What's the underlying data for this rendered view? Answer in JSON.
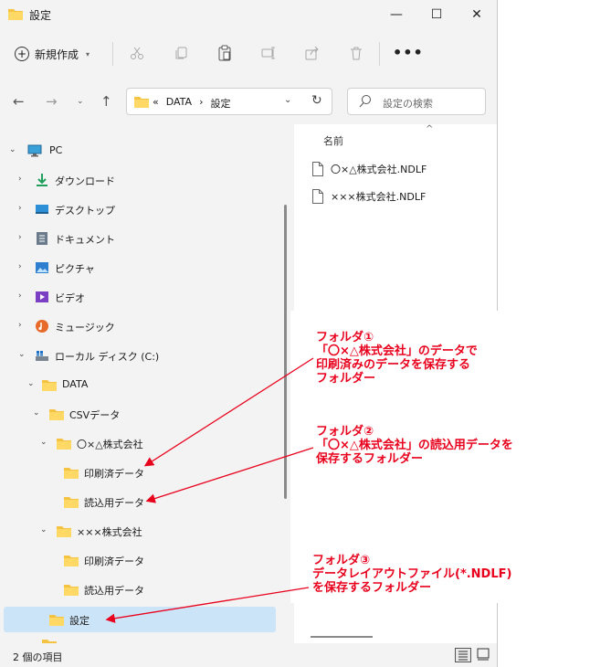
{
  "window": {
    "title": "設定",
    "controls": {
      "minimize": "—",
      "maximize": "☐",
      "close": "✕"
    }
  },
  "toolbar": {
    "new_label": "新規作成",
    "more": "•••",
    "icons": [
      "cut-icon",
      "copy-icon",
      "paste-icon",
      "rename-icon",
      "share-icon",
      "delete-icon"
    ]
  },
  "address": {
    "overflow": "«",
    "crumbs": [
      "DATA",
      "›",
      "設定"
    ]
  },
  "search": {
    "placeholder": "設定の検索"
  },
  "tree": [
    {
      "label": "PC"
    },
    {
      "label": "ダウンロード"
    },
    {
      "label": "デスクトップ"
    },
    {
      "label": "ドキュメント"
    },
    {
      "label": "ピクチャ"
    },
    {
      "label": "ビデオ"
    },
    {
      "label": "ミュージック"
    },
    {
      "label": "ローカル ディスク (C:)"
    },
    {
      "label": "DATA"
    },
    {
      "label": "CSVデータ"
    },
    {
      "label": "〇×△株式会社"
    },
    {
      "label": "印刷済データ"
    },
    {
      "label": "読込用データ"
    },
    {
      "label": "×××株式会社"
    },
    {
      "label": "印刷済データ"
    },
    {
      "label": "読込用データ"
    },
    {
      "label": "設定"
    }
  ],
  "content": {
    "column": "名前",
    "files": [
      "〇×△株式会社.NDLF",
      "×××株式会社.NDLF"
    ]
  },
  "status": {
    "count": "2 個の項目"
  },
  "annotations": [
    {
      "lines": [
        "フォルダ①",
        "「〇×△株式会社」のデータで",
        "印刷済みのデータを保存する",
        "フォルダー"
      ]
    },
    {
      "lines": [
        "フォルダ②",
        "「〇×△株式会社」の読込用データを",
        "保存するフォルダー"
      ]
    },
    {
      "lines": [
        "フォルダ③",
        "データレイアウトファイル(*.NDLF)",
        "を保存するフォルダー"
      ]
    }
  ],
  "colors": {
    "annotation": "#e8001c",
    "selection": "#cce4f7",
    "folder": "#f5c342"
  }
}
